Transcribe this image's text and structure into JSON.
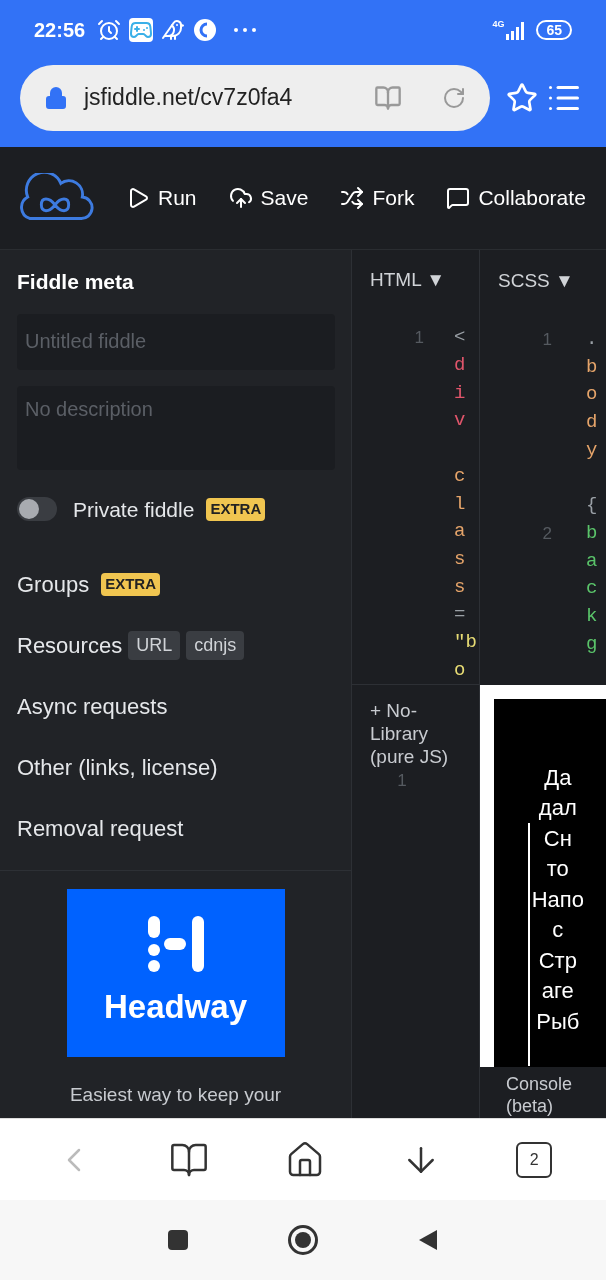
{
  "status_bar": {
    "time": "22:56",
    "network": "4G",
    "battery": "65"
  },
  "browser": {
    "url": "jsfiddle.net/cv7z0fa4",
    "tab_count": "2"
  },
  "toolbar": {
    "actions": [
      {
        "kind": "run",
        "label": "Run"
      },
      {
        "kind": "save",
        "label": "Save"
      },
      {
        "kind": "fork",
        "label": "Fork"
      },
      {
        "kind": "collaborate",
        "label": "Collaborate"
      }
    ]
  },
  "sidebar": {
    "title": "Fiddle meta",
    "title_field": {
      "placeholder": "Untitled fiddle"
    },
    "description_field": {
      "placeholder": "No description"
    },
    "private": {
      "label": "Private fiddle",
      "on": false,
      "badge": "EXTRA"
    },
    "items": [
      {
        "label": "Groups",
        "badges": [
          {
            "text": "EXTRA",
            "kind": "extra"
          }
        ]
      },
      {
        "label": "Resources",
        "badges": [
          {
            "text": "URL",
            "kind": "tag"
          },
          {
            "text": "cdnjs",
            "kind": "tag"
          }
        ]
      },
      {
        "label": "Async requests"
      },
      {
        "label": "Other (links, license)"
      },
      {
        "label": "Removal request"
      }
    ],
    "ad": {
      "brand": "Headway",
      "text": "Easiest way to keep your"
    }
  },
  "editors": [
    {
      "tab": "HTML ▼",
      "lines": [
        {
          "number": "1",
          "tokens": [
            {
              "text": "<",
              "kind": "punct"
            },
            {
              "text": "div",
              "kind": "tag"
            },
            {
              "text": "class",
              "kind": "attr",
              "space_before": true
            },
            {
              "text": "=",
              "kind": "punct"
            },
            {
              "text": "\"b",
              "kind": "quote"
            },
            {
              "text": "o",
              "kind": "string"
            }
          ]
        }
      ]
    },
    {
      "tab": "SCSS ▼",
      "lines": [
        {
          "number": "1",
          "tokens": [
            {
              "text": ".",
              "kind": "punct"
            },
            {
              "text": "body",
              "kind": "attr"
            },
            {
              "text": "{",
              "kind": "punct",
              "space_before": true
            }
          ]
        },
        {
          "number": "2",
          "tokens": [
            {
              "text": "backg",
              "kind": "property"
            }
          ]
        }
      ]
    }
  ],
  "js_panel": {
    "label": "+ No-Library (pure JS)",
    "line_number": "1"
  },
  "preview": {
    "lines": [
      "Да",
      "дал",
      "Сн",
      "то",
      "Напо",
      "с",
      "Стр",
      "аге",
      "Рыб"
    ]
  },
  "console": {
    "label": "Console (beta)"
  }
}
